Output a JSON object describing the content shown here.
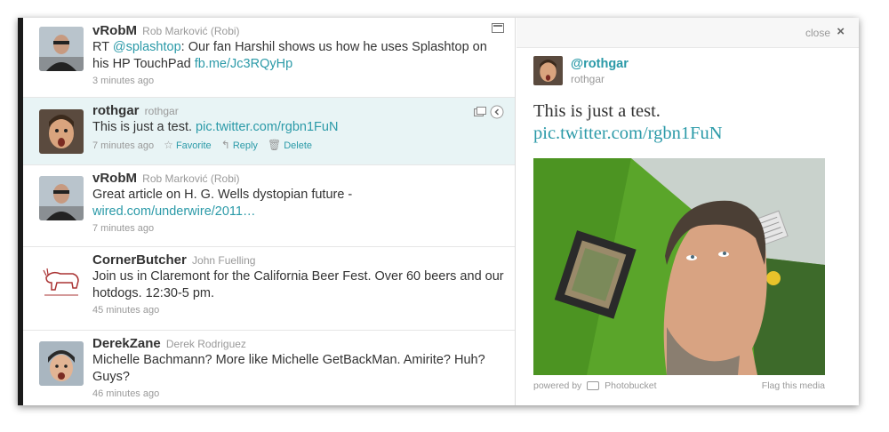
{
  "timeline": {
    "tweets": [
      {
        "screen_name": "vRobM",
        "full_name": "Rob Marković (Robi)",
        "text_prefix": "RT ",
        "mention": "@splashtop",
        "text_body": ": Our fan Harshil shows us how he uses Splashtop on his HP TouchPad ",
        "link": "fb.me/Jc3RQyHp",
        "time": "3 minutes ago"
      },
      {
        "screen_name": "rothgar",
        "full_name": "rothgar",
        "text_body": "This is just a test. ",
        "link": "pic.twitter.com/rgbn1FuN",
        "time": "7 minutes ago",
        "actions": {
          "favorite": "Favorite",
          "reply": "Reply",
          "delete": "Delete"
        }
      },
      {
        "screen_name": "vRobM",
        "full_name": "Rob Marković (Robi)",
        "text_body": "Great article on H. G. Wells dystopian future - ",
        "link": "wired.com/underwire/2011…",
        "time": "7 minutes ago"
      },
      {
        "screen_name": "CornerButcher",
        "full_name": "John Fuelling",
        "text_body": "Join us in Claremont for the California Beer Fest. Over 60 beers and our hotdogs. 12:30-5 pm.",
        "time": "45 minutes ago"
      },
      {
        "screen_name": "DerekZane",
        "full_name": "Derek Rodriguez",
        "text_body": "Michelle Bachmann? More like Michelle GetBackMan. Amirite? Huh? Guys?",
        "time": "46 minutes ago"
      }
    ]
  },
  "detail": {
    "close_label": "close",
    "close_glyph": "×",
    "handle": "@rothgar",
    "sub": "rothgar",
    "text": "This is just a test.",
    "link": "pic.twitter.com/rgbn1FuN",
    "powered_by": "powered by",
    "provider": "Photobucket",
    "flag": "Flag this media"
  },
  "colors": {
    "link": "#2b9aa8",
    "selected_bg": "#e8f4f5",
    "left_bar": "#1a1a1a"
  }
}
